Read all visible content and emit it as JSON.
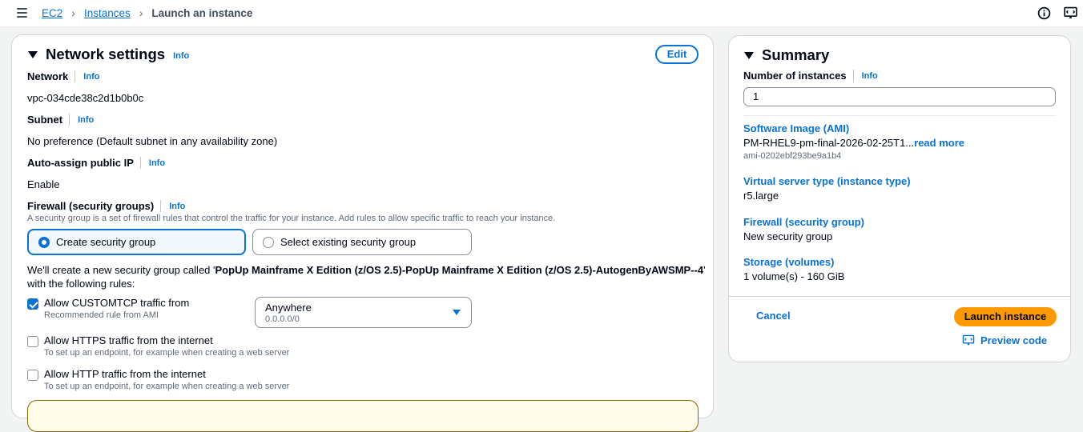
{
  "breadcrumb": {
    "root": "EC2",
    "parent": "Instances",
    "current": "Launch an instance"
  },
  "network": {
    "title": "Network settings",
    "info": "Info",
    "edit_label": "Edit",
    "network_label": "Network",
    "network_value": "vpc-034cde38c2d1b0b0c",
    "subnet_label": "Subnet",
    "subnet_value": "No preference (Default subnet in any availability zone)",
    "public_ip_label": "Auto-assign public IP",
    "public_ip_value": "Enable",
    "firewall_label": "Firewall (security groups)",
    "firewall_desc": "A security group is a set of firewall rules that control the traffic for your instance. Add rules to allow specific traffic to reach your instance.",
    "option_create": "Create security group",
    "option_existing": "Select existing security group",
    "sg_text_prefix": "We'll create a new security group called '",
    "sg_name": "PopUp Mainframe X Edition (z/OS 2.5)-PopUp Mainframe X Edition (z/OS 2.5)-AutogenByAWSMP--4",
    "sg_text_suffix": "'",
    "sg_text_line2": "with the following rules:",
    "rules": [
      {
        "label": "Allow CUSTOMTCP traffic from",
        "desc": "Recommended rule from AMI",
        "checked": true
      },
      {
        "label": "Allow HTTPS traffic from the internet",
        "desc": "To set up an endpoint, for example when creating a web server",
        "checked": false
      },
      {
        "label": "Allow HTTP traffic from the internet",
        "desc": "To set up an endpoint, for example when creating a web server",
        "checked": false
      }
    ],
    "source_select": {
      "value": "Anywhere",
      "sub": "0.0.0.0/0"
    }
  },
  "summary": {
    "title": "Summary",
    "num_instances_label": "Number of instances",
    "info": "Info",
    "num_instances_value": "1",
    "ami_label": "Software Image (AMI)",
    "ami_value": "PM-RHEL9-pm-final-2026-02-25T1...",
    "ami_read_more": "read more",
    "ami_id": "ami-0202ebf293be9a1b4",
    "type_label": "Virtual server type (instance type)",
    "type_value": "r5.large",
    "firewall_label": "Firewall (security group)",
    "firewall_value": "New security group",
    "storage_label": "Storage (volumes)",
    "storage_value": "1 volume(s) - 160 GiB",
    "cancel_label": "Cancel",
    "launch_label": "Launch instance",
    "preview_label": "Preview code"
  }
}
